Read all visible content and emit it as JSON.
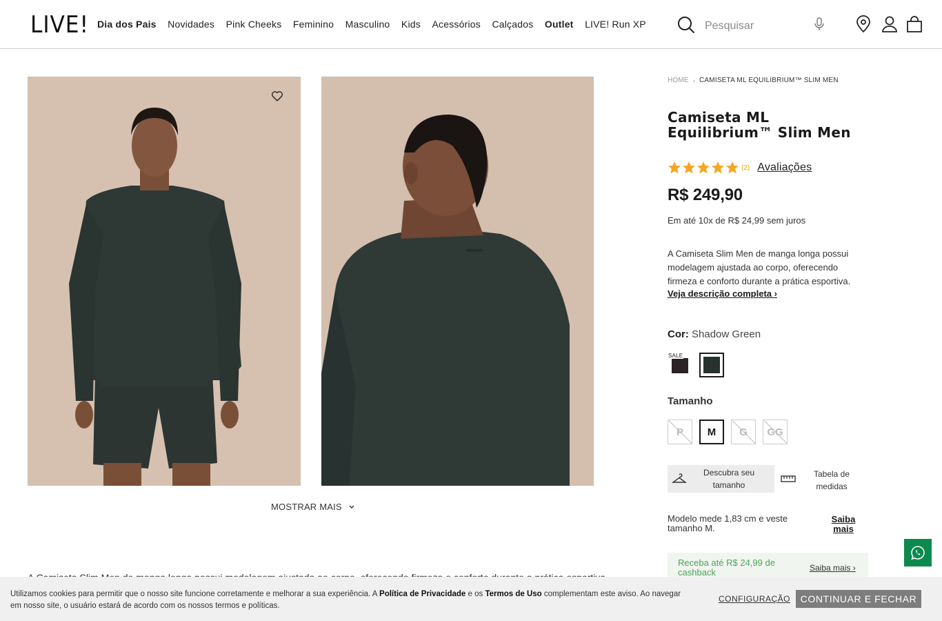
{
  "header": {
    "logo": "LIVE!",
    "nav": [
      {
        "label": "Dia dos Pais",
        "bold": true
      },
      {
        "label": "Novidades",
        "bold": false
      },
      {
        "label": "Pink Cheeks",
        "bold": false
      },
      {
        "label": "Feminino",
        "bold": false
      },
      {
        "label": "Masculino",
        "bold": false
      },
      {
        "label": "Kids",
        "bold": false
      },
      {
        "label": "Acessórios",
        "bold": false
      },
      {
        "label": "Calçados",
        "bold": false
      },
      {
        "label": "Outlet",
        "bold": true
      },
      {
        "label": "LIVE! Run XP",
        "bold": false
      }
    ],
    "search_placeholder": "Pesquisar",
    "icons": [
      "search-icon",
      "microphone-icon",
      "location-pin-icon",
      "user-icon",
      "shopping-bag-icon"
    ]
  },
  "gallery": {
    "show_more": "MOSTRAR MAIS",
    "bottom_text": "A Camiseta Slim Men de manga longa possui modelagem ajustada ao corpo, oferecendo firmeza e conforto durante a prática esportiva."
  },
  "product": {
    "breadcrumb": {
      "home": "HOME",
      "current": "CAMISETA ML EQUILIBRIUM™ SLIM MEN"
    },
    "title": "Camiseta ML Equilibrium™ Slim Men",
    "rating": {
      "stars": 5,
      "count": "(2)",
      "reviews_label": "Avaliações"
    },
    "price": "R$ 249,90",
    "installments": "Em até 10x de R$ 24,99 sem juros",
    "short_description": "A Camiseta Slim Men de manga longa possui modelagem ajustada ao corpo, oferecendo firmeza e conforto durante a prática esportiva.",
    "full_description_link": "Veja descrição completa ›",
    "color": {
      "label": "Cor:",
      "value": "Shadow Green",
      "sale_badge": "SALE",
      "swatches": [
        "#2b2226",
        "#27322f"
      ]
    },
    "size": {
      "label": "Tamanho",
      "options": [
        {
          "label": "P",
          "state": "disabled"
        },
        {
          "label": "M",
          "state": "selected"
        },
        {
          "label": "G",
          "state": "disabled"
        },
        {
          "label": "GG",
          "state": "disabled"
        }
      ]
    },
    "discover_size": "Descubra seu tamanho",
    "size_table": "Tabela de medidas",
    "model_info": "Modelo mede 1,83 cm e veste tamanho M.",
    "model_more": "Saiba mais",
    "cashback": {
      "text": "Receba até R$ 24,99 de cashback",
      "more": "Saiba mais ›"
    }
  },
  "cookie": {
    "msg_before": "Utilizamos cookies para permitir que o nosso site funcione corretamente e melhorar a sua experiência. A ",
    "privacy": "Política de Privacidade",
    "msg_mid": " e os ",
    "terms": "Termos de Uso",
    "msg_after": " complementam este aviso. Ao navegar em nosso site, o usuário estará de acordo com os nossos termos e políticas.",
    "config": "CONFIGURAÇÃO",
    "accept": "CONTINUAR E FECHAR"
  },
  "colors": {
    "accent_green": "#0c8a4e",
    "star": "#f5a623",
    "cashback_text": "#4aa55b"
  }
}
